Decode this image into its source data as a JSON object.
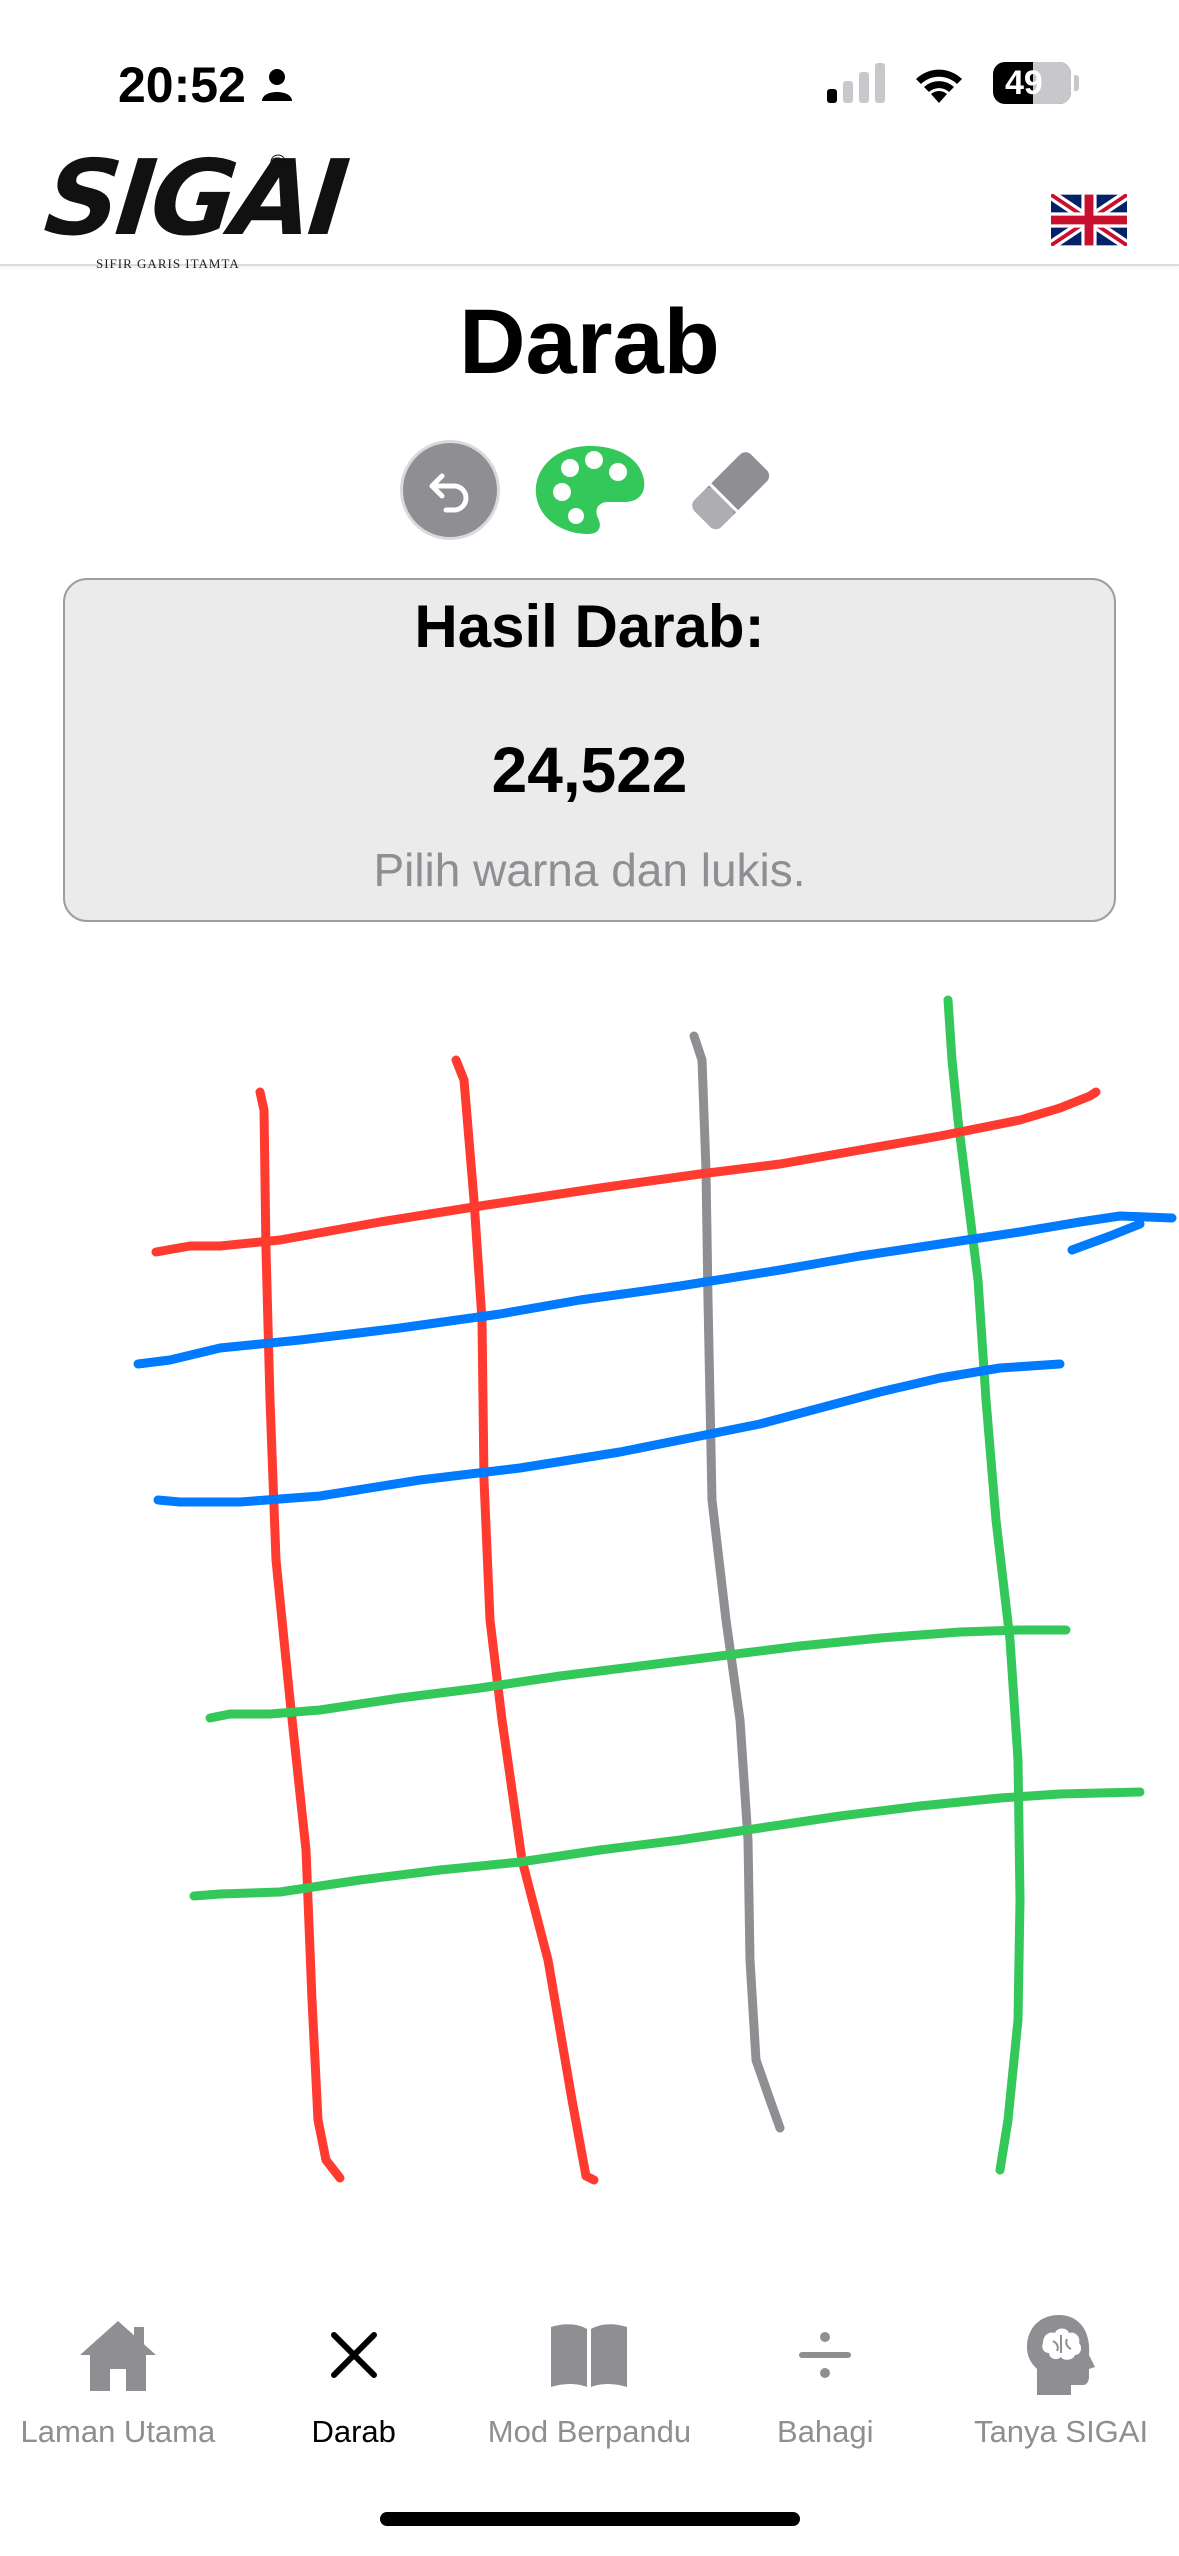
{
  "status": {
    "time": "20:52",
    "battery": "49"
  },
  "header": {
    "logo_text": "SIGAI",
    "logo_registered": "®",
    "logo_subtitle": "SIFIR GARIS ITAMTA",
    "language_flag": "uk-flag-icon"
  },
  "page": {
    "title": "Darab"
  },
  "toolbar": {
    "undo_icon": "undo-icon",
    "palette_icon": "palette-icon",
    "eraser_icon": "eraser-icon"
  },
  "result": {
    "heading": "Hasil Darab:",
    "value": "24,522",
    "hint": "Pilih warna dan lukis."
  },
  "canvas": {
    "stroke_colors": {
      "red": "#ff3b30",
      "blue": "#007aff",
      "gray": "#8e8e93",
      "green": "#34c759"
    }
  },
  "colors": {
    "accent_green": "#34c759",
    "inactive": "#8e8e93",
    "card_bg": "#ebebeb"
  },
  "tabbar": {
    "tabs": [
      {
        "label": "Laman Utama",
        "icon": "home-icon",
        "active": false
      },
      {
        "label": "Darab",
        "icon": "multiply-icon",
        "active": true
      },
      {
        "label": "Mod Berpandu",
        "icon": "book-icon",
        "active": false
      },
      {
        "label": "Bahagi",
        "icon": "divide-icon",
        "active": false
      },
      {
        "label": "Tanya SIGAI",
        "icon": "brain-head-icon",
        "active": false
      }
    ]
  }
}
